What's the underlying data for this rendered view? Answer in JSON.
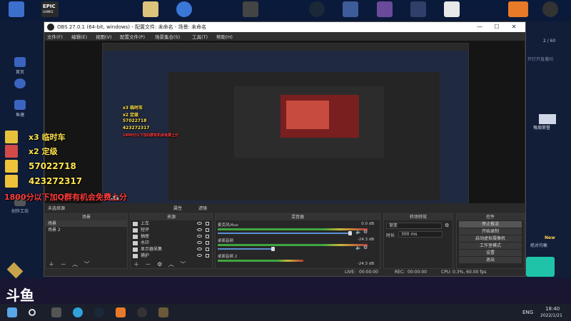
{
  "desktop": {
    "icons": [
      {
        "name": "computer-icon",
        "label": ""
      },
      {
        "name": "epic-games-icon",
        "label": "EPIC\nGAMES"
      },
      {
        "name": "folder-icon",
        "label": ""
      },
      {
        "name": "app-icon",
        "label": ""
      },
      {
        "name": "drive-icon",
        "label": ""
      },
      {
        "name": "steam-icon",
        "label": ""
      },
      {
        "name": "game-icon",
        "label": ""
      },
      {
        "name": "game2-icon",
        "label": ""
      },
      {
        "name": "game3-icon",
        "label": ""
      },
      {
        "name": "file-icon",
        "label": ""
      },
      {
        "name": "game4-icon",
        "label": ""
      },
      {
        "name": "obs-icon",
        "label": ""
      }
    ],
    "epic_label": "EPIC",
    "epic_sub": "GAMES"
  },
  "left_panel": {
    "items": [
      {
        "icon": "home-icon",
        "label": "首页"
      },
      {
        "icon": "discover-icon",
        "label": ""
      },
      {
        "icon": "fish-icon",
        "label": "鱼塘"
      },
      {
        "icon": "notes-icon",
        "label": ""
      },
      {
        "icon": "creator-icon",
        "label": "创作工坊"
      }
    ]
  },
  "right_panel": {
    "page_indicator": "2 / 60",
    "side_text1": "开打开直播间",
    "weekly_label": "每周荣誉",
    "new_badge": "New",
    "info_label": "绝对均衡"
  },
  "obs": {
    "title": "OBS 27.0.1 (64-bit, windows) - 配置文件: 未命名 - 场景: 未命名",
    "menu": [
      "文件(F)",
      "编辑(E)",
      "视图(V)",
      "配置文件(P)",
      "场景集合(S)",
      "工具(T)",
      "帮助(H)"
    ],
    "preview_overlay": {
      "line1": "x3 临时车",
      "line2": "x2 定级",
      "line3": "57022718",
      "line4": "423272317",
      "bottom_red": "1800分以下加Q群有机会免费上分"
    },
    "scene_label": "未选择源",
    "properties_btn": "属性",
    "filters_btn": "滤镜",
    "docks": {
      "scenes": {
        "title": "场景",
        "items": [
          "场景",
          "场景 2"
        ]
      },
      "sources": {
        "title": "来源",
        "items": [
          "上车",
          "短评",
          "抽屉",
          "水印",
          "显示器采集",
          "捕护"
        ]
      },
      "mixer": {
        "title": "混音器",
        "channels": [
          {
            "name": "麦克风/Aux",
            "db": "0.0 dB"
          },
          {
            "name": "桌面音频",
            "db": "-24.3 dB"
          },
          {
            "name": "桌面音频 2",
            "db": "-24.3 dB"
          }
        ]
      },
      "transitions": {
        "title": "转场特效",
        "value": "渐变",
        "duration_label": "时长",
        "duration_value": "300 ms"
      },
      "controls": {
        "title": "控件",
        "buttons": [
          "停止推流",
          "开始录制",
          "启动虚拟摄像机",
          "工作室模式",
          "设置",
          "退出"
        ]
      }
    },
    "status": {
      "live_label": "LIVE:",
      "live_time": "00:00:00",
      "rec_label": "REC:",
      "rec_time": "00:00:00",
      "cpu": "CPU: 0.3%, 60.00 fps"
    }
  },
  "taskbar": {
    "time": "18:40",
    "date": "2022/1/21",
    "lang": "ENG"
  },
  "watermark": "斗鱼",
  "watermark_sub": "斗鱼"
}
